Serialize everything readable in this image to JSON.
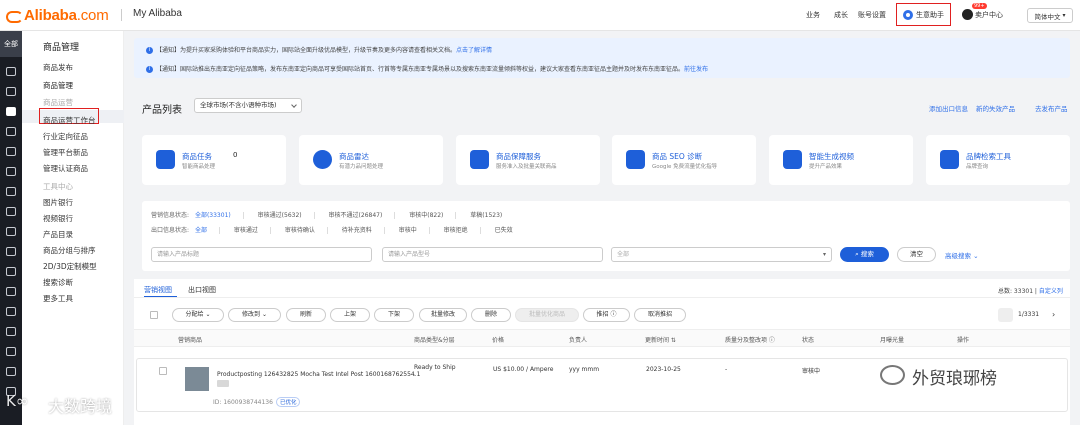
{
  "header": {
    "brand": "Alibaba",
    "brand_suffix": ".com",
    "section": "My Alibaba",
    "nav": [
      "业务",
      "成长",
      "账号设置"
    ],
    "assistant": "生意助手",
    "seller_center": "卖户中心",
    "badge": "99+",
    "language": "简体中文"
  },
  "rail": {
    "all_label": "全部"
  },
  "sidebar": {
    "title": "商品管理",
    "items": [
      {
        "label": "商品发布",
        "state": "normal"
      },
      {
        "label": "商品管理",
        "state": "active"
      },
      {
        "label": "商品运营",
        "state": "header"
      },
      {
        "label": "商品运营工作台",
        "state": "normal"
      },
      {
        "label": "行业定向征品",
        "state": "normal"
      },
      {
        "label": "管理平台新品",
        "state": "normal"
      },
      {
        "label": "管理认证商品",
        "state": "normal"
      },
      {
        "label": "工具中心",
        "state": "header"
      },
      {
        "label": "图片银行",
        "state": "normal"
      },
      {
        "label": "视频银行",
        "state": "normal"
      },
      {
        "label": "产品目录",
        "state": "normal"
      },
      {
        "label": "商品分组与排序",
        "state": "normal"
      },
      {
        "label": "2D/3D定制模型",
        "state": "normal"
      },
      {
        "label": "搜索诊断",
        "state": "normal"
      },
      {
        "label": "更多工具",
        "state": "normal"
      }
    ]
  },
  "notices": [
    {
      "prefix": "【通知】为提升买家采购体验和平台商品实力，国际站全面升级优品模型，升级节奏及更多内容请查看相关文档。",
      "link": "点击了解详情"
    },
    {
      "prefix": "【通知】国际站推出东南亚定向征品策略，发布东南亚定向商品可享受国际站首页、行首等专属东南亚专属场景以及搜索东南亚流量倾斜等权益，建议大家查看东南亚征品主题并及时发布东南亚征品。",
      "link": "前往发布"
    }
  ],
  "product_list": {
    "title": "产品列表",
    "market_select": "全球市场(不含小语种市场)",
    "links": [
      "添加出口信息",
      "新的失效产品",
      "去发布产品"
    ]
  },
  "cards": [
    {
      "title": "商品任务",
      "sub": "智能商品处理",
      "count": "0"
    },
    {
      "title": "商品雷达",
      "sub": "有潜力品问题处理",
      "count": ""
    },
    {
      "title": "商品保障服务",
      "sub": "服务准入及批量关联商品",
      "count": ""
    },
    {
      "title": "商品 SEO 诊断",
      "sub": "Google 免费流量优化指导",
      "count": ""
    },
    {
      "title": "智能生成视频",
      "sub": "提升产品效果",
      "count": ""
    },
    {
      "title": "品牌检索工具",
      "sub": "品牌查询",
      "count": ""
    }
  ],
  "filters": {
    "row1_label": "营销信息状态:",
    "row1": [
      "全部(33301)",
      "审核通过(5632)",
      "审核不通过(26847)",
      "审核中(822)",
      "草稿(1523)"
    ],
    "row2_label": "出口信息状态:",
    "row2": [
      "全部",
      "审核通过",
      "审核待确认",
      "待补充资料",
      "审核中",
      "审核拒绝",
      "已失效"
    ],
    "inputs": [
      "请输入产品标题",
      "请输入产品型号",
      "全部"
    ],
    "search_btn": "搜索",
    "clear_btn": "清空",
    "advanced": "高级搜索"
  },
  "list": {
    "tabs": [
      "营销视图",
      "出口视图"
    ],
    "total_label": "总数: 33301 |",
    "total_link": "自定义列",
    "toolbar": [
      "分配给",
      "修改到",
      "刷新",
      "上架",
      "下架",
      "批量修改",
      "删除",
      "批量优化商品",
      "推招",
      "取消推招"
    ],
    "page": "1/3331",
    "columns": [
      "营销商品",
      "商品类型&分层",
      "价格",
      "负责人",
      "更新时间",
      "质量分及整改项",
      "状态",
      "月曝光量",
      "操作"
    ],
    "rows": [
      {
        "title": "Productposting 126432825 Mocha Test Intel Post 1600168762554 1",
        "id": "ID: 1600938744136",
        "optimized": "已优化",
        "type": "Ready to Ship",
        "type_sub": "-",
        "price": "US $10.00 / Ampere",
        "owner": "yyy mmm",
        "updated": "2023-10-25",
        "quality": "-",
        "status": "审核中"
      }
    ]
  },
  "watermarks": {
    "left": "大数跨境",
    "left_mark": "K∞",
    "right": "外贸琅琊榜"
  }
}
